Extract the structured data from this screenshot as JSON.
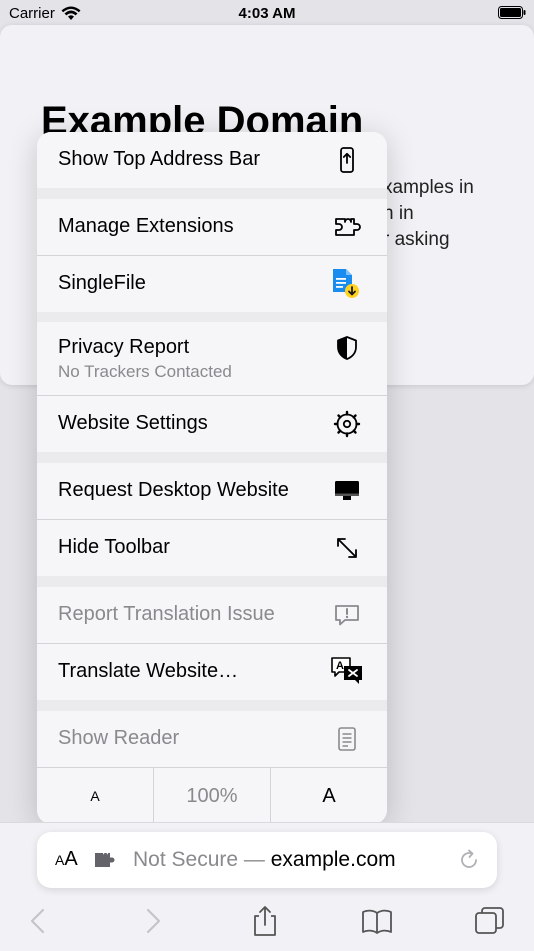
{
  "status_bar": {
    "carrier": "Carrier",
    "time": "4:03 AM"
  },
  "web": {
    "title": "Example Domain",
    "line1": "xamples in",
    "line2": "n in",
    "line3": "r asking"
  },
  "menu": {
    "show_top_address_bar": "Show Top Address Bar",
    "manage_extensions": "Manage Extensions",
    "singlefile": "SingleFile",
    "privacy_report": "Privacy Report",
    "privacy_sub": "No Trackers Contacted",
    "website_settings": "Website Settings",
    "request_desktop": "Request Desktop Website",
    "hide_toolbar": "Hide Toolbar",
    "report_translation": "Report Translation Issue",
    "translate_website": "Translate Website…",
    "show_reader": "Show Reader",
    "zoom_small": "A",
    "zoom_level": "100%",
    "zoom_large": "A"
  },
  "address_bar": {
    "aa_small": "A",
    "aa_large": "A",
    "not_secure": "Not Secure —",
    "domain": "example.com"
  },
  "colors": {
    "accent": "#007aff",
    "dim": "#8a8a8e",
    "singlefile_blue": "#1a8cf0",
    "singlefile_yellow": "#ffd21f"
  },
  "icons": [
    "wifi-icon",
    "battery-icon",
    "address-bar-icon",
    "extension-icon",
    "singlefile-icon",
    "shield-icon",
    "gear-icon",
    "desktop-icon",
    "resize-icon",
    "translation-issue-icon",
    "translate-icon",
    "reader-icon",
    "reload-icon",
    "back-icon",
    "forward-icon",
    "share-icon",
    "bookmarks-icon",
    "tabs-icon"
  ]
}
